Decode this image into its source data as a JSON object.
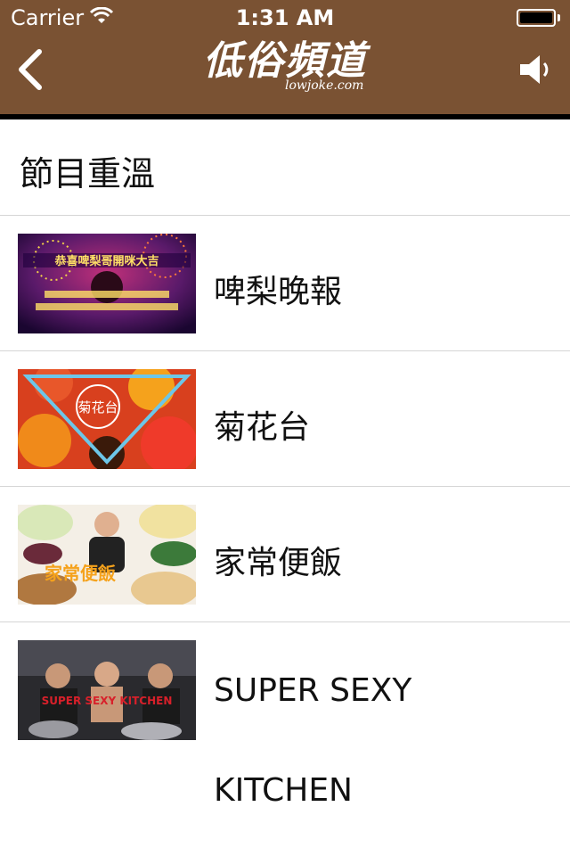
{
  "status_bar": {
    "carrier": "Carrier",
    "time": "1:31 AM"
  },
  "nav": {
    "logo_cn": "低俗頻道",
    "logo_en": "lowjoke.com",
    "back_icon": "chevron-left-icon",
    "speaker_icon": "speaker-icon"
  },
  "section": {
    "title": "節目重溫"
  },
  "programs": [
    {
      "label": "啤梨晚報",
      "thumb_text": "恭喜啤梨哥開咪大吉"
    },
    {
      "label": "菊花台",
      "thumb_text": "菊花台"
    },
    {
      "label": "家常便飯",
      "thumb_text": "家常便飯"
    },
    {
      "label_line1": "SUPER SEXY",
      "label_line2": "KITCHEN",
      "thumb_text": "SUPER SEXY KITCHEN"
    }
  ],
  "colors": {
    "header": "#7a5233",
    "divider": "#d6d6d6",
    "text": "#111111"
  }
}
